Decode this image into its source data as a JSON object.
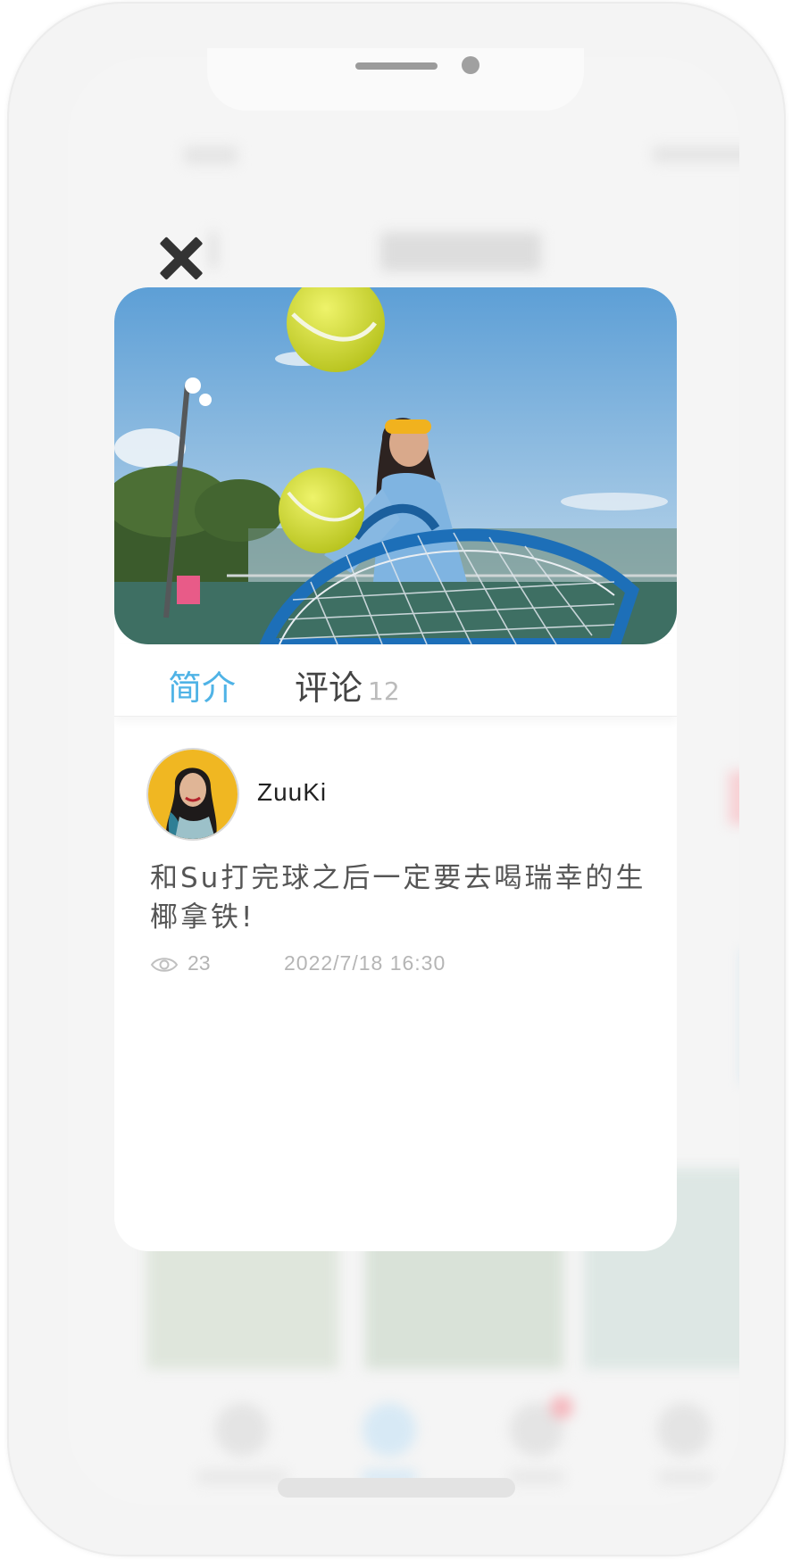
{
  "modal": {
    "tabs": [
      {
        "label": "简介"
      },
      {
        "label": "评论",
        "count": "12"
      }
    ],
    "post": {
      "username": "ZuuKi",
      "text": "和Su打完球之后一定要去喝瑞幸的生椰拿铁!",
      "views": "23",
      "timestamp": "2022/7/18 16:30"
    }
  },
  "colors": {
    "accent": "#4fb3e6",
    "tab_inactive": "#444444",
    "meta_text": "#b5b5b5"
  },
  "icons": {
    "close": "close-icon",
    "views": "eye-icon"
  }
}
